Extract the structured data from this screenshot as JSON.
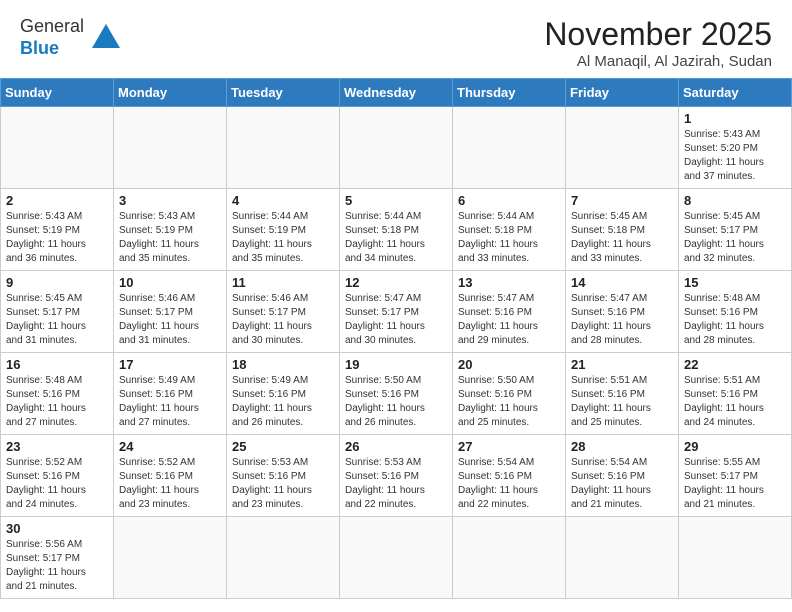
{
  "header": {
    "logo_general": "General",
    "logo_blue": "Blue",
    "month_title": "November 2025",
    "location": "Al Manaqil, Al Jazirah, Sudan"
  },
  "weekdays": [
    "Sunday",
    "Monday",
    "Tuesday",
    "Wednesday",
    "Thursday",
    "Friday",
    "Saturday"
  ],
  "days": [
    {
      "day": null,
      "info": null
    },
    {
      "day": null,
      "info": null
    },
    {
      "day": null,
      "info": null
    },
    {
      "day": null,
      "info": null
    },
    {
      "day": null,
      "info": null
    },
    {
      "day": null,
      "info": null
    },
    {
      "day": "1",
      "info": "Sunrise: 5:43 AM\nSunset: 5:20 PM\nDaylight: 11 hours\nand 37 minutes."
    },
    {
      "day": "2",
      "info": "Sunrise: 5:43 AM\nSunset: 5:19 PM\nDaylight: 11 hours\nand 36 minutes."
    },
    {
      "day": "3",
      "info": "Sunrise: 5:43 AM\nSunset: 5:19 PM\nDaylight: 11 hours\nand 35 minutes."
    },
    {
      "day": "4",
      "info": "Sunrise: 5:44 AM\nSunset: 5:19 PM\nDaylight: 11 hours\nand 35 minutes."
    },
    {
      "day": "5",
      "info": "Sunrise: 5:44 AM\nSunset: 5:18 PM\nDaylight: 11 hours\nand 34 minutes."
    },
    {
      "day": "6",
      "info": "Sunrise: 5:44 AM\nSunset: 5:18 PM\nDaylight: 11 hours\nand 33 minutes."
    },
    {
      "day": "7",
      "info": "Sunrise: 5:45 AM\nSunset: 5:18 PM\nDaylight: 11 hours\nand 33 minutes."
    },
    {
      "day": "8",
      "info": "Sunrise: 5:45 AM\nSunset: 5:17 PM\nDaylight: 11 hours\nand 32 minutes."
    },
    {
      "day": "9",
      "info": "Sunrise: 5:45 AM\nSunset: 5:17 PM\nDaylight: 11 hours\nand 31 minutes."
    },
    {
      "day": "10",
      "info": "Sunrise: 5:46 AM\nSunset: 5:17 PM\nDaylight: 11 hours\nand 31 minutes."
    },
    {
      "day": "11",
      "info": "Sunrise: 5:46 AM\nSunset: 5:17 PM\nDaylight: 11 hours\nand 30 minutes."
    },
    {
      "day": "12",
      "info": "Sunrise: 5:47 AM\nSunset: 5:17 PM\nDaylight: 11 hours\nand 30 minutes."
    },
    {
      "day": "13",
      "info": "Sunrise: 5:47 AM\nSunset: 5:16 PM\nDaylight: 11 hours\nand 29 minutes."
    },
    {
      "day": "14",
      "info": "Sunrise: 5:47 AM\nSunset: 5:16 PM\nDaylight: 11 hours\nand 28 minutes."
    },
    {
      "day": "15",
      "info": "Sunrise: 5:48 AM\nSunset: 5:16 PM\nDaylight: 11 hours\nand 28 minutes."
    },
    {
      "day": "16",
      "info": "Sunrise: 5:48 AM\nSunset: 5:16 PM\nDaylight: 11 hours\nand 27 minutes."
    },
    {
      "day": "17",
      "info": "Sunrise: 5:49 AM\nSunset: 5:16 PM\nDaylight: 11 hours\nand 27 minutes."
    },
    {
      "day": "18",
      "info": "Sunrise: 5:49 AM\nSunset: 5:16 PM\nDaylight: 11 hours\nand 26 minutes."
    },
    {
      "day": "19",
      "info": "Sunrise: 5:50 AM\nSunset: 5:16 PM\nDaylight: 11 hours\nand 26 minutes."
    },
    {
      "day": "20",
      "info": "Sunrise: 5:50 AM\nSunset: 5:16 PM\nDaylight: 11 hours\nand 25 minutes."
    },
    {
      "day": "21",
      "info": "Sunrise: 5:51 AM\nSunset: 5:16 PM\nDaylight: 11 hours\nand 25 minutes."
    },
    {
      "day": "22",
      "info": "Sunrise: 5:51 AM\nSunset: 5:16 PM\nDaylight: 11 hours\nand 24 minutes."
    },
    {
      "day": "23",
      "info": "Sunrise: 5:52 AM\nSunset: 5:16 PM\nDaylight: 11 hours\nand 24 minutes."
    },
    {
      "day": "24",
      "info": "Sunrise: 5:52 AM\nSunset: 5:16 PM\nDaylight: 11 hours\nand 23 minutes."
    },
    {
      "day": "25",
      "info": "Sunrise: 5:53 AM\nSunset: 5:16 PM\nDaylight: 11 hours\nand 23 minutes."
    },
    {
      "day": "26",
      "info": "Sunrise: 5:53 AM\nSunset: 5:16 PM\nDaylight: 11 hours\nand 22 minutes."
    },
    {
      "day": "27",
      "info": "Sunrise: 5:54 AM\nSunset: 5:16 PM\nDaylight: 11 hours\nand 22 minutes."
    },
    {
      "day": "28",
      "info": "Sunrise: 5:54 AM\nSunset: 5:16 PM\nDaylight: 11 hours\nand 21 minutes."
    },
    {
      "day": "29",
      "info": "Sunrise: 5:55 AM\nSunset: 5:17 PM\nDaylight: 11 hours\nand 21 minutes."
    },
    {
      "day": "30",
      "info": "Sunrise: 5:56 AM\nSunset: 5:17 PM\nDaylight: 11 hours\nand 21 minutes."
    },
    {
      "day": null,
      "info": null
    },
    {
      "day": null,
      "info": null
    },
    {
      "day": null,
      "info": null
    },
    {
      "day": null,
      "info": null
    },
    {
      "day": null,
      "info": null
    }
  ]
}
